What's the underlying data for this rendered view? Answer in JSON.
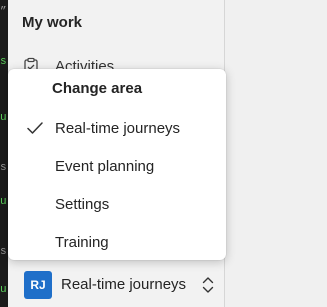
{
  "nav": {
    "section_title": "My work",
    "activities_label": "Activities",
    "activities_icon": "clipboard-icon"
  },
  "area_menu": {
    "header": "Change area",
    "items": [
      {
        "label": "Real-time journeys",
        "selected": true
      },
      {
        "label": "Event planning",
        "selected": false
      },
      {
        "label": "Settings",
        "selected": false
      },
      {
        "label": "Training",
        "selected": false
      }
    ],
    "check_icon": "checkmark-icon"
  },
  "area_switcher": {
    "avatar_initials": "RJ",
    "avatar_color": "#1f6fc9",
    "label": "Real-time journeys",
    "icon": "chevron-up-down-icon"
  },
  "background_strip": {
    "marks": [
      "”",
      "s",
      "u",
      "s",
      "u",
      "s",
      "u"
    ]
  }
}
